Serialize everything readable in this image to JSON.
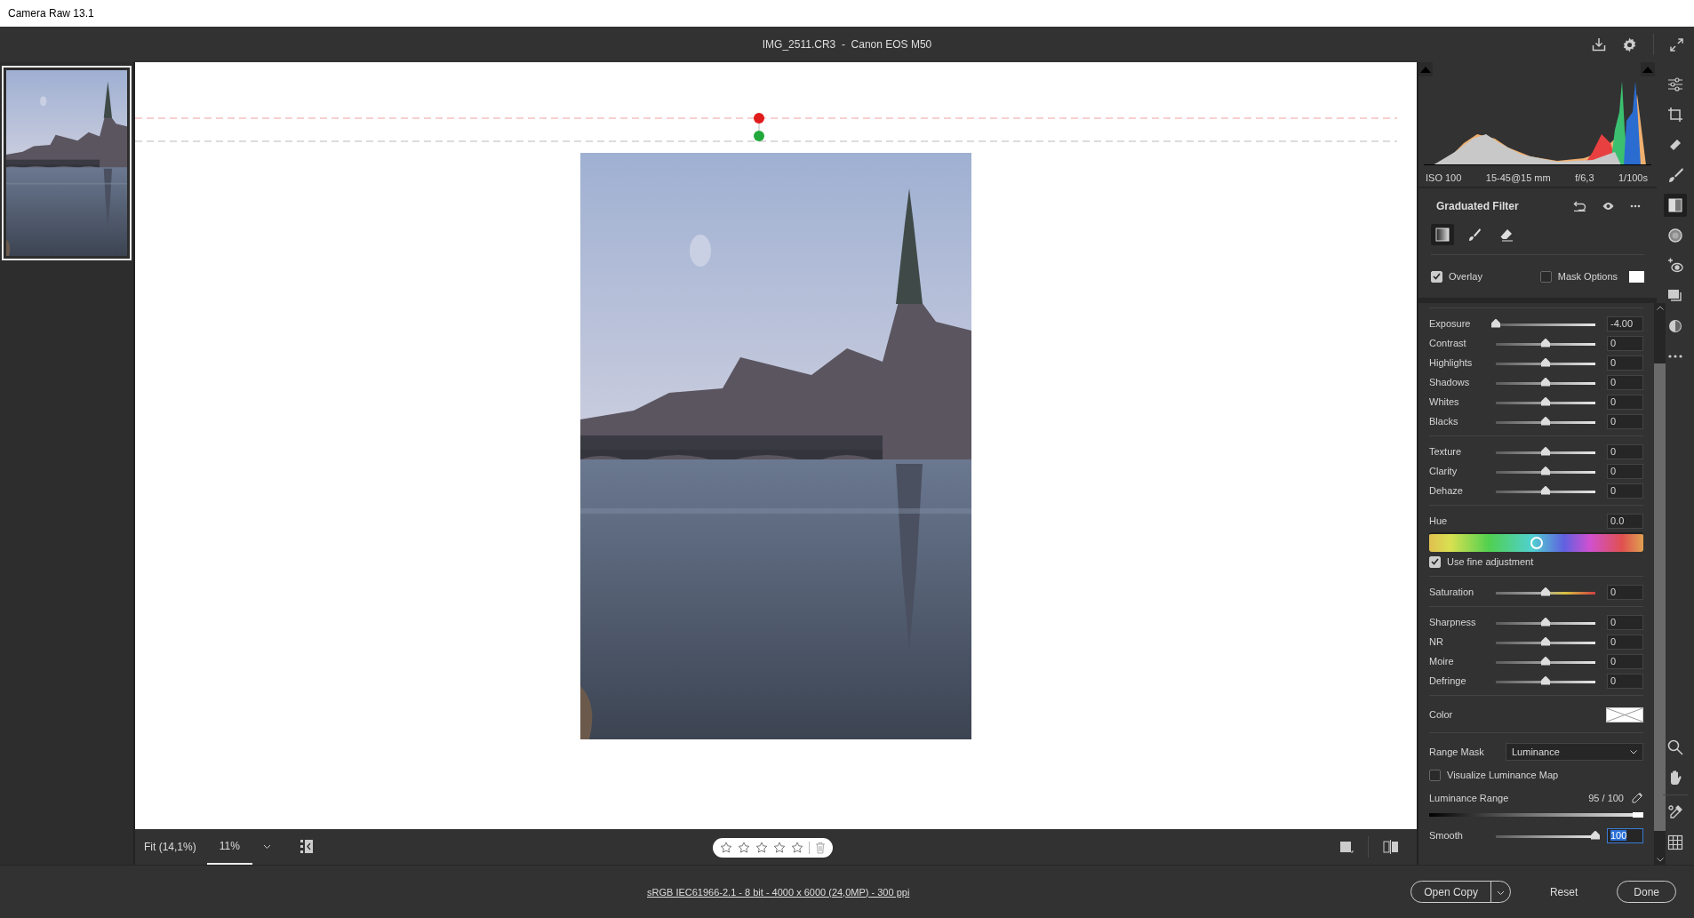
{
  "window": {
    "title": "Camera Raw 13.1"
  },
  "header": {
    "file": "IMG_2511.CR3  -  Canon EOS M50"
  },
  "filmstrip": [
    {
      "kind": "picture",
      "selected": true
    }
  ],
  "histogram": {
    "exif": [
      "ISO 100",
      "15-45@15 mm",
      "f/6,3",
      "1/100s"
    ]
  },
  "panel": {
    "title": "Graduated Filter",
    "modes": [
      {
        "kind": "gradient",
        "selected": true
      },
      {
        "kind": "brush",
        "selected": false
      },
      {
        "kind": "eraser",
        "selected": false
      }
    ],
    "overlay": {
      "label": "Overlay",
      "checked": true
    },
    "mask_options": {
      "label": "Mask Options",
      "checked": false
    },
    "groups": [
      [
        {
          "kind": "slider",
          "label": "Exposure",
          "value": "-4.00",
          "level": 0
        },
        {
          "kind": "slider",
          "label": "Contrast",
          "value": "0",
          "level": 0.5
        },
        {
          "kind": "slider",
          "label": "Highlights",
          "value": "0",
          "level": 0.5
        },
        {
          "kind": "slider",
          "label": "Shadows",
          "value": "0",
          "level": 0.5
        },
        {
          "kind": "slider",
          "label": "Whites",
          "value": "0",
          "level": 0.5
        },
        {
          "kind": "slider",
          "label": "Blacks",
          "value": "0",
          "level": 0.5
        }
      ],
      [
        {
          "kind": "slider",
          "label": "Texture",
          "value": "0",
          "level": 0.5
        },
        {
          "kind": "slider",
          "label": "Clarity",
          "value": "0",
          "level": 0.5
        },
        {
          "kind": "slider",
          "label": "Dehaze",
          "value": "0",
          "level": 0.5
        }
      ],
      [
        {
          "kind": "hue",
          "label": "Hue",
          "value": "0.0",
          "level": 0.5
        },
        {
          "kind": "checkbox",
          "label": "Use fine adjustment",
          "checked": true
        }
      ],
      [
        {
          "kind": "color-slider",
          "label": "Saturation",
          "value": "0",
          "level": 0.5
        }
      ],
      [
        {
          "kind": "slider",
          "label": "Sharpness",
          "value": "0",
          "level": 0.5
        },
        {
          "kind": "slider",
          "label": "NR",
          "value": "0",
          "level": 0.5
        },
        {
          "kind": "slider",
          "label": "Moire",
          "value": "0",
          "level": 0.5
        },
        {
          "kind": "slider",
          "label": "Defringe",
          "value": "0",
          "level": 0.5
        }
      ],
      [
        {
          "kind": "swatch",
          "label": "Color"
        }
      ],
      [
        {
          "kind": "dropdown",
          "label": "Range Mask",
          "value": "Luminance"
        },
        {
          "kind": "checkbox",
          "label": "Visualize Luminance Map",
          "checked": false
        },
        {
          "kind": "range",
          "label": "Luminance Range",
          "value": "95 / 100",
          "level": 0.95
        },
        {
          "kind": "slider",
          "label": "Smooth",
          "value": "100",
          "level": 1,
          "focused": true
        }
      ]
    ]
  },
  "tools": [
    {
      "kind": "edit",
      "selected": false
    },
    {
      "kind": "crop",
      "selected": false
    },
    {
      "kind": "heal",
      "selected": false
    },
    {
      "kind": "brush",
      "selected": false
    },
    {
      "kind": "gradient",
      "selected": true
    },
    {
      "kind": "radial",
      "selected": false
    },
    {
      "kind": "redeye",
      "selected": false
    },
    {
      "kind": "snapshots",
      "selected": false
    },
    {
      "kind": "presets",
      "selected": false
    },
    {
      "kind": "more",
      "selected": false
    }
  ],
  "view_tools": [
    {
      "kind": "zoom"
    },
    {
      "kind": "hand"
    },
    {
      "kind": "sampler"
    },
    {
      "kind": "grid"
    }
  ],
  "toolbar": {
    "fit": "Fit (14,1%)",
    "zoom": "11%",
    "stars": 0
  },
  "footer": {
    "info": "sRGB IEC61966-2.1 - 8 bit - 4000 x 6000 (24,0MP) - 300 ppi",
    "buttons": [
      {
        "kind": "split",
        "label": "Open Copy"
      },
      {
        "kind": "plain",
        "label": "Reset"
      },
      {
        "kind": "outline",
        "label": "Done"
      }
    ]
  }
}
